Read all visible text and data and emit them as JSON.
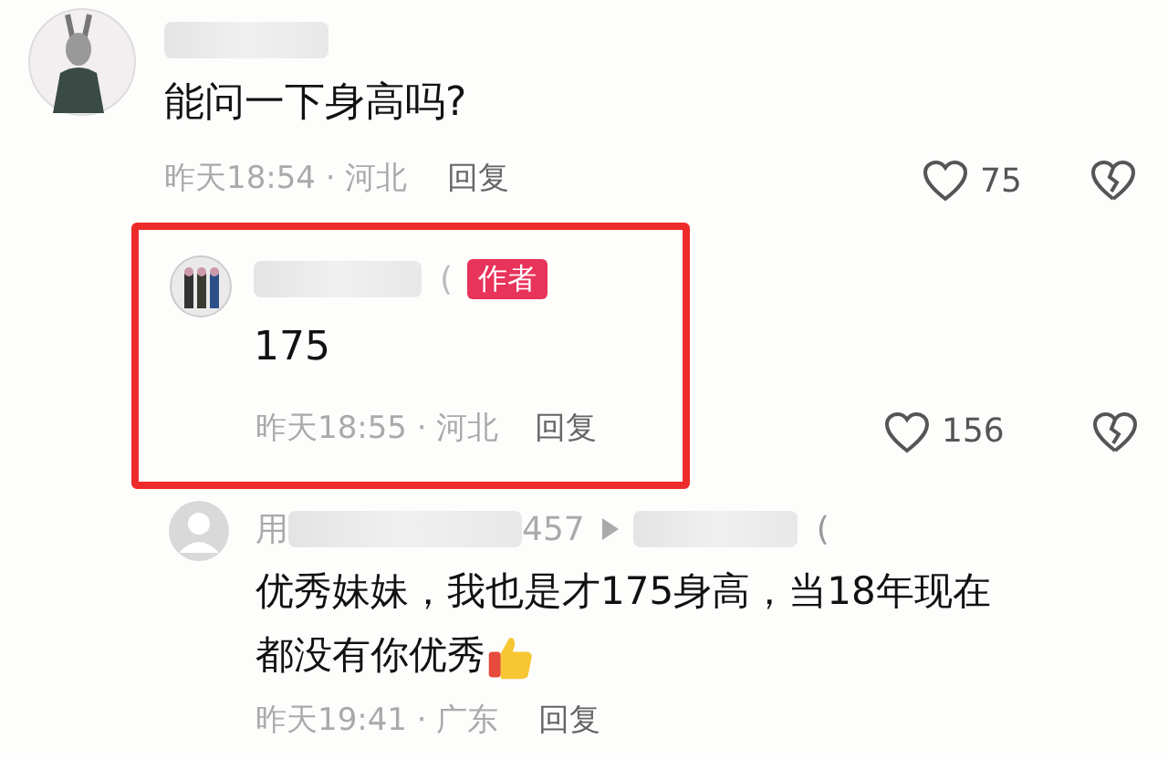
{
  "comments": [
    {
      "text": "能问一下身高吗?",
      "time": "昨天18:54 · 河北",
      "reply": "回复",
      "likes": "75",
      "highlighted": false
    },
    {
      "paren": "(",
      "author_badge": "作者",
      "text": "175",
      "time": "昨天18:55 · 河北",
      "reply": "回复",
      "likes": "156",
      "highlighted": true
    }
  ],
  "reply": {
    "name_start": "用",
    "name_end": "457",
    "paren": "(",
    "text_lines": [
      "优秀妹妹，我也是才175身高，当18年现在",
      "都没有你优秀"
    ],
    "time": "昨天19:41 · 广东",
    "reply": "回复"
  }
}
